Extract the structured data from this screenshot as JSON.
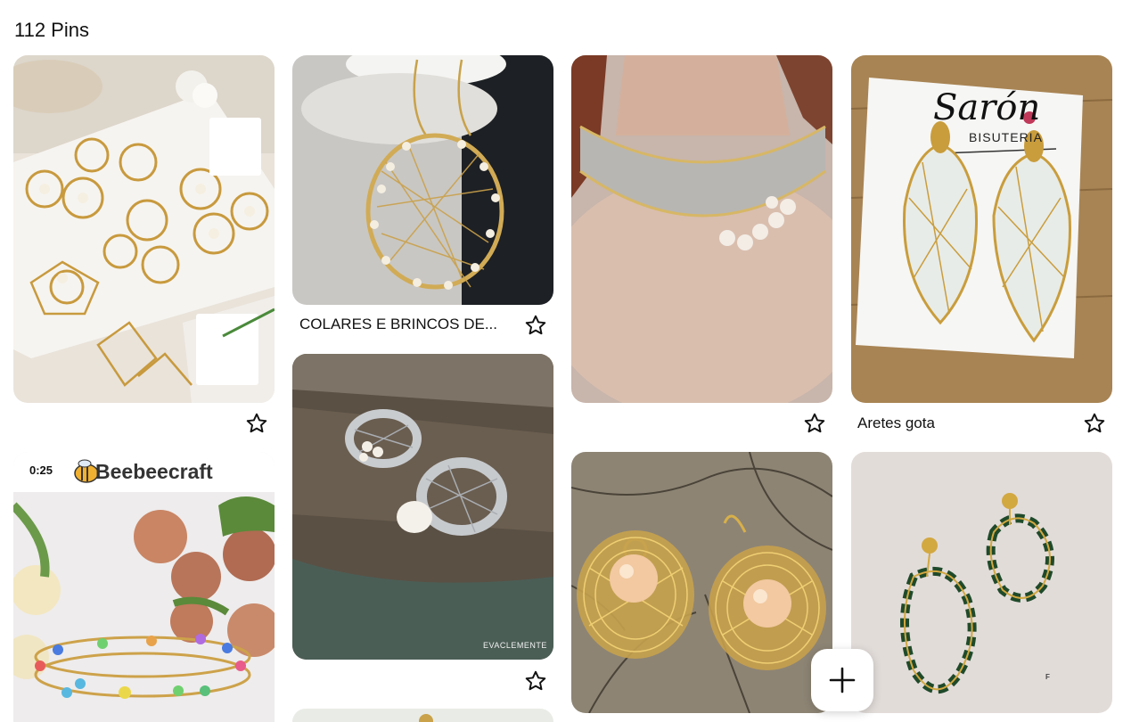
{
  "board": {
    "pin_count": "112 Pins"
  },
  "pins": [
    {
      "title": "",
      "subject": "gold wire flower stud earrings with pearls"
    },
    {
      "title": "COLARES E BRINCOS DE...",
      "subject": "gold wire crochet hoop earrings with pearls"
    },
    {
      "title": "",
      "subject": "silver and gold crochet wire necklace with pearls"
    },
    {
      "title": "Aretes gota",
      "subject": "gold wire teardrop earrings with crystal beads",
      "card_text": {
        "brand": "Sarón",
        "tagline": "BISUTERIA"
      }
    },
    {
      "title": "",
      "subject": "wire bangle bracelet with colored crystal beads",
      "badge": "0:25",
      "brand": "Beebeecraft"
    },
    {
      "title": "",
      "subject": "silver crochet wire rings with pearls",
      "watermark": "EVACLEMENTE"
    },
    {
      "title": "",
      "subject": "gold crochet wire earrings with peach pearls"
    },
    {
      "title": "",
      "subject": "gold wire leaf earrings with dark green beads"
    }
  ],
  "icons": {
    "save": "star-outline-icon",
    "create": "plus-icon"
  }
}
